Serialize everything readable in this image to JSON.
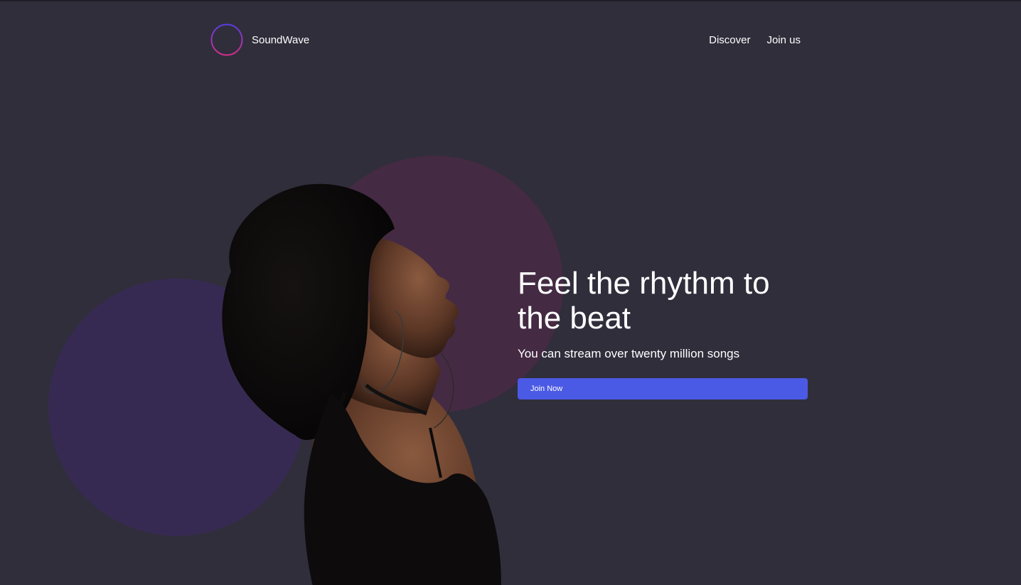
{
  "brand": {
    "name": "SoundWave",
    "logo_icon": "soundwave-logo-icon"
  },
  "nav": {
    "items": [
      {
        "label": "Discover"
      },
      {
        "label": "Join us"
      }
    ]
  },
  "hero": {
    "title": "Feel the rhythm to the beat",
    "subtitle": "You can stream over twenty million songs",
    "cta_label": "Join Now",
    "image": "woman-listening-to-music-photo"
  },
  "colors": {
    "background": "#302e3b",
    "accent": "#4b5ae4",
    "circle_pink": "#442a43",
    "circle_purple": "#372a52",
    "logo_gradient_start": "#5a3be0",
    "logo_gradient_end": "#d22f8c"
  }
}
